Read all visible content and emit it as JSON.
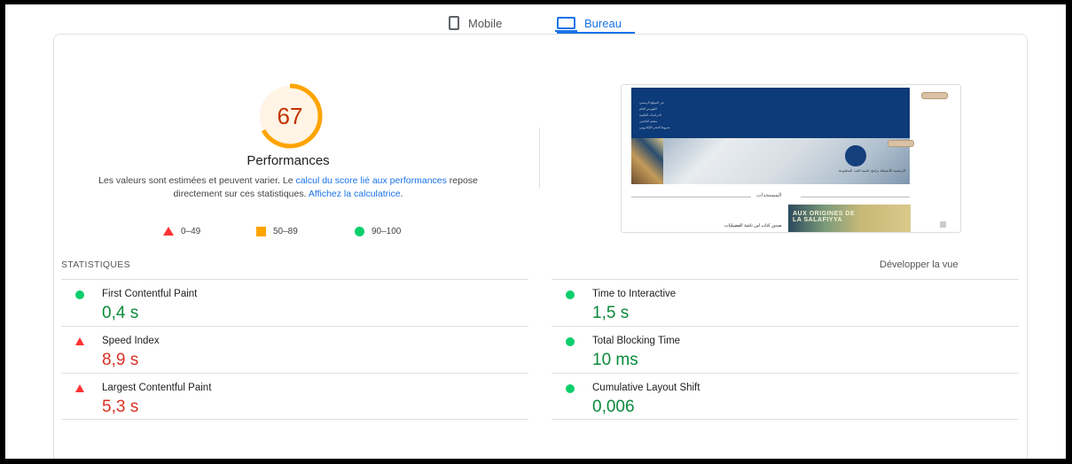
{
  "tabs": {
    "mobile_label": "Mobile",
    "desktop_label": "Bureau",
    "active": "Bureau",
    "active_color": "#1a73e8"
  },
  "score": {
    "value": "67",
    "fraction": 0.67,
    "color": "#ffa400",
    "text_color": "#c33300"
  },
  "performance": {
    "title": "Performances",
    "desc_pre": "Les valeurs sont estimées et peuvent varier. Le ",
    "link1": "calcul du score lié aux performances",
    "desc_mid": " repose directement sur ces statistiques. ",
    "link2": "Affichez la calculatrice",
    "desc_end": "."
  },
  "legend": [
    {
      "range": "0–49",
      "shape": "triangle",
      "color": "#ff3333"
    },
    {
      "range": "50–89",
      "shape": "square",
      "color": "#ffa400"
    },
    {
      "range": "90–100",
      "shape": "circle",
      "color": "#0cce6b"
    }
  ],
  "thumbnail": {
    "menu_items": [
      "عن الموقع الرسمي",
      "الفهرس العام",
      "الدراسات العلمية",
      "معجم الباحثين",
      "شروط النشر الإلكتروني"
    ],
    "nav_text": "الرئيسية الأنشطة برامج علمية العدد المطبوعة",
    "section_title": "المستجدات",
    "book_title_line1": "AUX ORIGINES DE",
    "book_title_line2": "LA SALAFIYYA",
    "caption": "صدور كتاب لبن ناشة الفضيليات"
  },
  "stats": {
    "header": "STATISTIQUES",
    "expand_label": "Développer la vue",
    "left": [
      {
        "name": "First Contentful Paint",
        "value": "0,4 s",
        "status": "pass"
      },
      {
        "name": "Speed Index",
        "value": "8,9 s",
        "status": "fail"
      },
      {
        "name": "Largest Contentful Paint",
        "value": "5,3 s",
        "status": "fail"
      }
    ],
    "right": [
      {
        "name": "Time to Interactive",
        "value": "1,5 s",
        "status": "pass"
      },
      {
        "name": "Total Blocking Time",
        "value": "10 ms",
        "status": "pass"
      },
      {
        "name": "Cumulative Layout Shift",
        "value": "0,006",
        "status": "pass"
      }
    ]
  }
}
